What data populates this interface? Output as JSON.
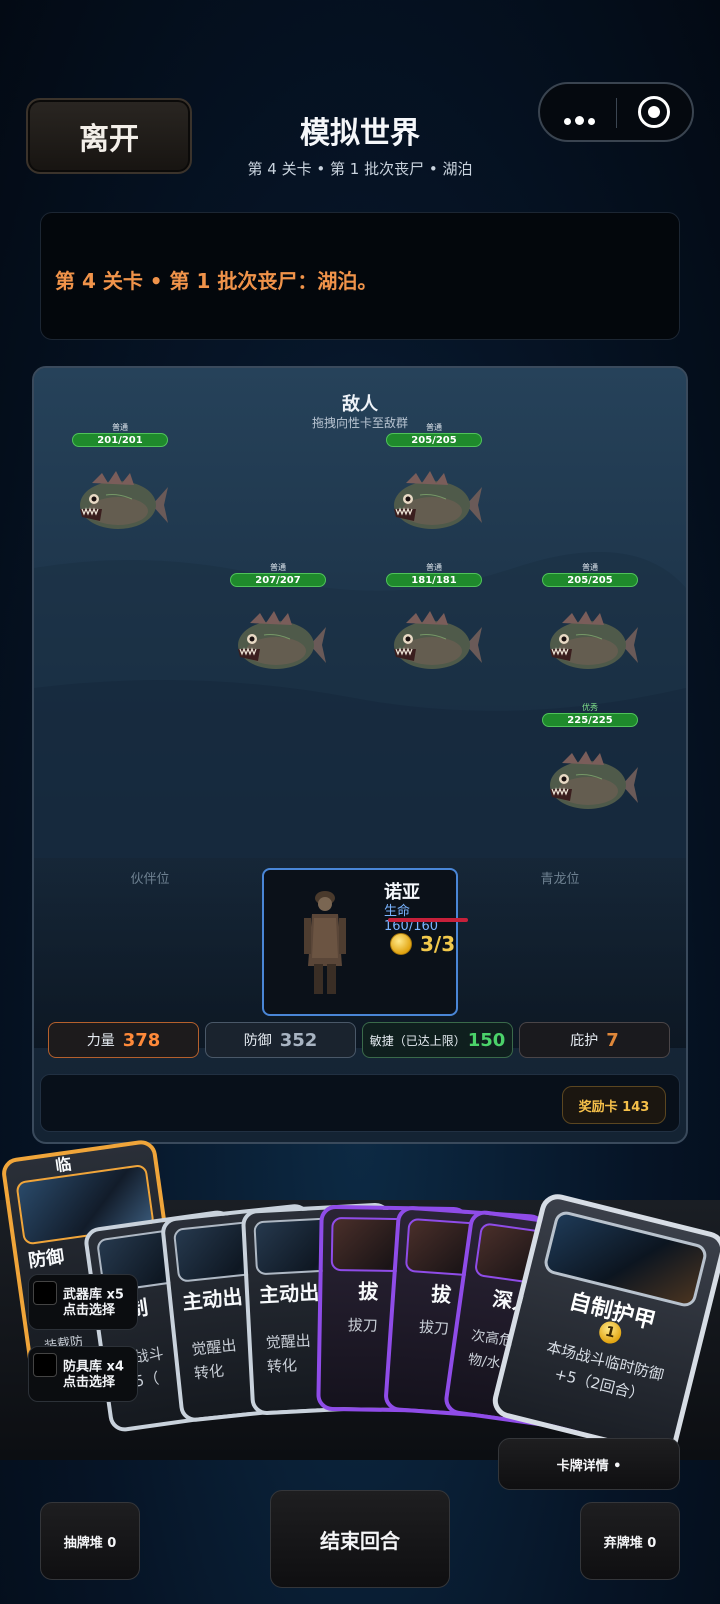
{
  "header": {
    "leave_label": "离开",
    "title": "模拟世界",
    "subtitle": "第 4 关卡 • 第 1 批次丧尸 • 湖泊"
  },
  "message": "第 4 关卡 • 第 1 批次丧尸：湖泊。",
  "battle": {
    "enemy_title": "敌人",
    "enemy_hint": "拖拽向性卡至敌群",
    "enemies": [
      {
        "rank": "普通",
        "hp": "201/201"
      },
      {
        "rank": "普通",
        "hp": "205/205"
      },
      {
        "rank": "普通",
        "hp": "207/207"
      },
      {
        "rank": "普通",
        "hp": "181/181"
      },
      {
        "rank": "普通",
        "hp": "205/205"
      },
      {
        "rank": "优秀",
        "hp": "225/225"
      }
    ],
    "partner_slot": "伙伴位",
    "dragon_slot": "青龙位",
    "hero": {
      "name": "诺亚",
      "hp_label": "生命 160/160",
      "energy": "3/3"
    },
    "stats": [
      {
        "label": "力量",
        "value": "378"
      },
      {
        "label": "防御",
        "value": "352"
      },
      {
        "label": "敏捷（已达上限）",
        "value": "150"
      },
      {
        "label": "庇护",
        "value": "7"
      }
    ],
    "reward_cards": "奖励卡 143"
  },
  "hand": {
    "orange_card_title": "临",
    "orange_card_title2": "防御",
    "orange_card_desc": "装载防",
    "cards": [
      {
        "name": "自制",
        "desc1": "场战斗",
        "desc2": "+5（"
      },
      {
        "name": "主动出",
        "desc1": "觉醒出",
        "desc2": "转化"
      },
      {
        "name": "主动出",
        "desc1": "觉醒出",
        "desc2": "转化"
      },
      {
        "name": "拔",
        "desc1": "拔刀",
        "desc2": ""
      },
      {
        "name": "拔",
        "desc1": "拔刀",
        "desc2": ""
      },
      {
        "name": "深入",
        "desc1": "次高危搜",
        "desc2": "物/水"
      }
    ],
    "front_card": {
      "name": "自制护甲",
      "cost": "1",
      "desc1": "本场战斗临时防御",
      "desc2": "+5（2回合）"
    },
    "weapon_deck": {
      "title": "武器库 x5",
      "hint": "点击选择"
    },
    "armor_deck": {
      "title": "防具库 x4",
      "hint": "点击选择"
    },
    "card_detail": "卡牌详情 •"
  },
  "footer": {
    "draw_pile": "抽牌堆 0",
    "end_turn": "结束回合",
    "discard_pile": "弃牌堆 0"
  }
}
